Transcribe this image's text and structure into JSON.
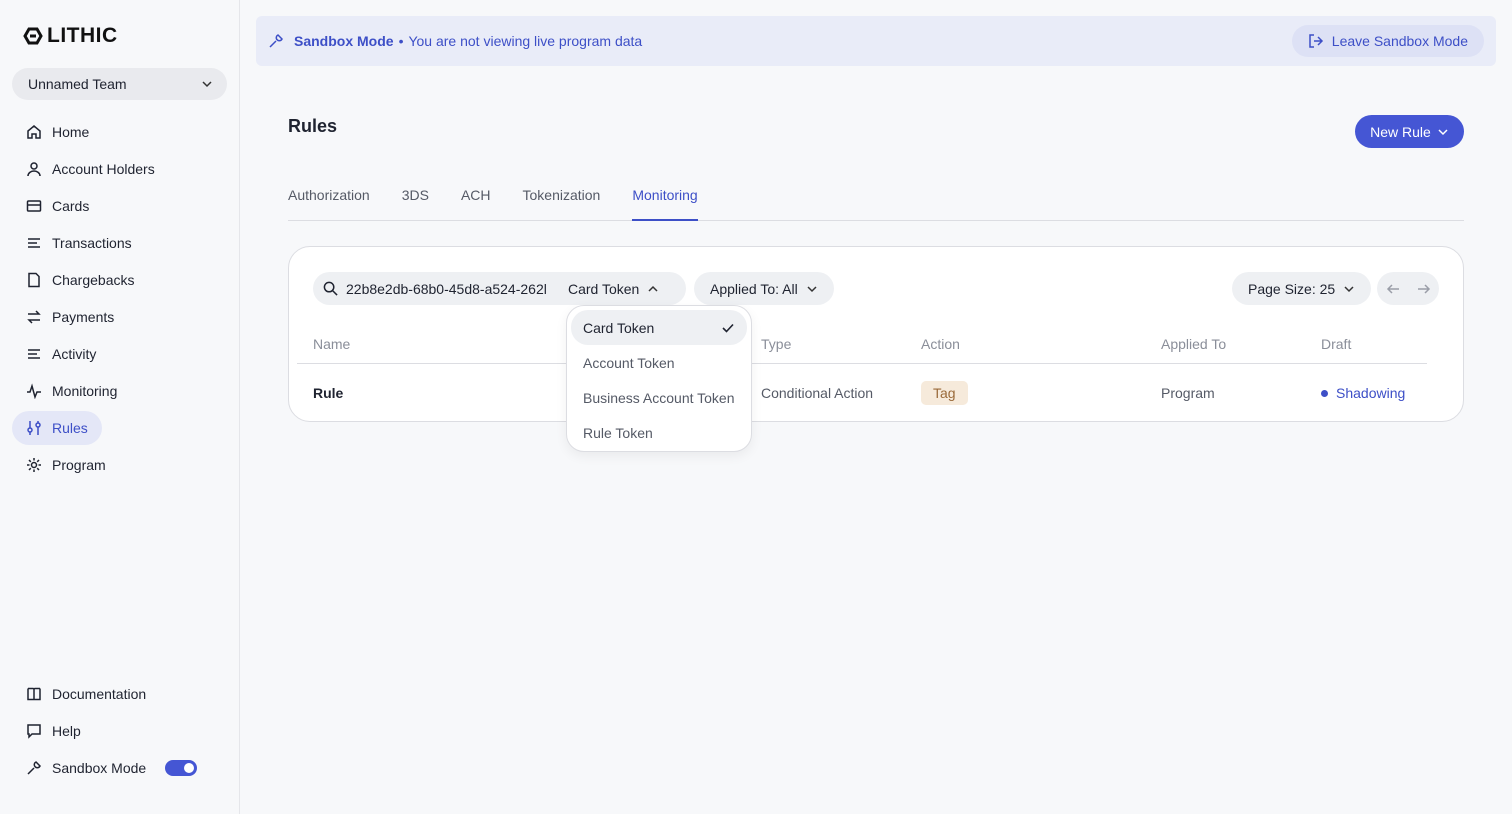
{
  "brand": {
    "name": "LITHIC"
  },
  "team": {
    "name": "Unnamed Team"
  },
  "sidebar": {
    "items": [
      {
        "label": "Home",
        "icon": "home-icon"
      },
      {
        "label": "Account Holders",
        "icon": "user-icon"
      },
      {
        "label": "Cards",
        "icon": "card-icon"
      },
      {
        "label": "Transactions",
        "icon": "list-icon"
      },
      {
        "label": "Chargebacks",
        "icon": "document-icon"
      },
      {
        "label": "Payments",
        "icon": "transfer-icon"
      },
      {
        "label": "Activity",
        "icon": "list-icon"
      },
      {
        "label": "Monitoring",
        "icon": "pulse-icon"
      },
      {
        "label": "Rules",
        "icon": "sliders-icon",
        "active": true
      },
      {
        "label": "Program",
        "icon": "gear-icon"
      }
    ],
    "bottom": [
      {
        "label": "Documentation",
        "icon": "book-icon"
      },
      {
        "label": "Help",
        "icon": "chat-icon"
      },
      {
        "label": "Sandbox Mode",
        "icon": "wrench-icon",
        "toggle": true
      }
    ]
  },
  "banner": {
    "title": "Sandbox Mode",
    "separator": "•",
    "message": "You are not viewing live program data",
    "leave_label": "Leave Sandbox Mode"
  },
  "page": {
    "title": "Rules",
    "new_rule_label": "New Rule",
    "tabs": [
      "Authorization",
      "3DS",
      "ACH",
      "Tokenization",
      "Monitoring"
    ],
    "active_tab": "Monitoring"
  },
  "filters": {
    "search_value": "22b8e2db-68b0-45d8-a524-262l",
    "token_type": "Card Token",
    "applied_to": "Applied To: All",
    "page_size": "Page Size: 25"
  },
  "table": {
    "headers": [
      "Name",
      "Type",
      "Action",
      "Applied To",
      "Draft"
    ],
    "rows": [
      {
        "name": "Rule",
        "type": "Conditional Action",
        "action": "Tag",
        "applied_to": "Program",
        "draft": "Shadowing"
      }
    ]
  },
  "dropdown": {
    "options": [
      "Card Token",
      "Account Token",
      "Business Account Token",
      "Rule Token"
    ],
    "selected": "Card Token"
  },
  "colors": {
    "accent": "#4556d4",
    "tag_bg": "#f6eadb",
    "banner_bg": "#e9ecf8"
  }
}
